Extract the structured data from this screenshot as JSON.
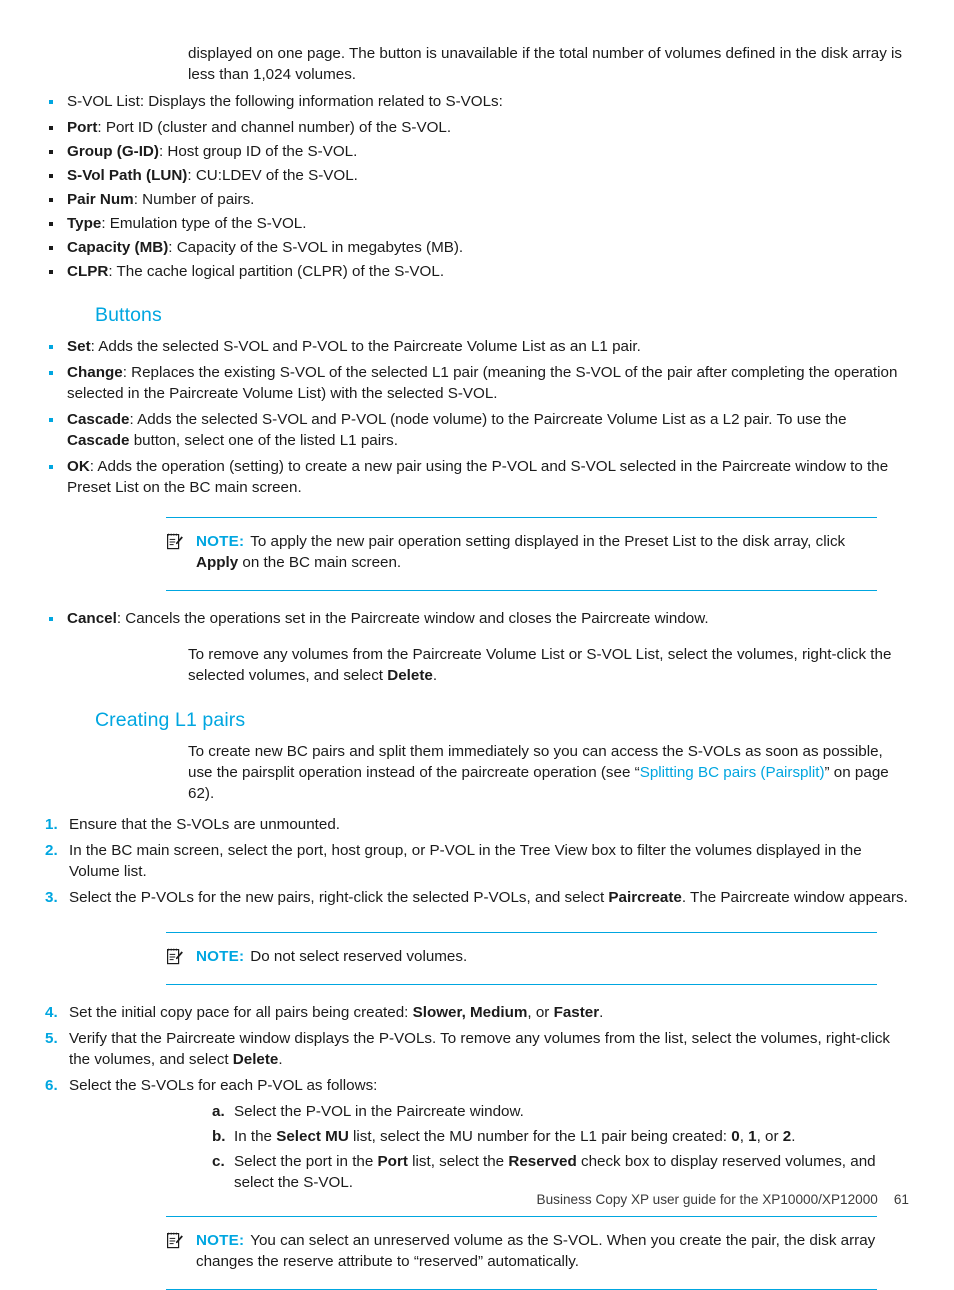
{
  "document": {
    "footer_text": "Business Copy XP user guide for the XP10000/XP12000",
    "page_number": "61"
  },
  "colors": {
    "accent": "#00a6e0",
    "text": "#1b1b1b"
  },
  "intro": {
    "continuation_paragraph": "displayed on one page. The button is unavailable if the total number of volumes defined in the disk array is less than 1,024 volumes.",
    "svol_list_bullet": "S-VOL List: Displays the following information related to S-VOLs:",
    "svol_fields": [
      {
        "term": "Port",
        "desc": ": Port ID (cluster and channel number) of the S-VOL."
      },
      {
        "term": "Group (G-ID)",
        "desc": ": Host group ID of the S-VOL."
      },
      {
        "term": "S-Vol Path (LUN)",
        "desc": ": CU:LDEV of the S-VOL."
      },
      {
        "term": "Pair Num",
        "desc": ": Number of pairs."
      },
      {
        "term": "Type",
        "desc": ": Emulation type of the S-VOL."
      },
      {
        "term": "Capacity (MB)",
        "desc": ": Capacity of the S-VOL in megabytes (MB)."
      },
      {
        "term": "CLPR",
        "desc": ": The cache logical partition (CLPR) of the S-VOL."
      }
    ]
  },
  "buttons_section": {
    "heading": "Buttons",
    "items": [
      {
        "term": "Set",
        "desc": ": Adds the selected S-VOL and P-VOL to the Paircreate Volume List as an L1 pair."
      },
      {
        "term": "Change",
        "desc": ": Replaces the existing S-VOL of the selected L1 pair (meaning the S-VOL of the pair after completing the operation selected in the Paircreate Volume List) with the selected S-VOL."
      },
      {
        "term": "Cascade",
        "desc_1": ": Adds the selected S-VOL and P-VOL (node volume) to the Paircreate Volume List as a L2 pair. To use the ",
        "emphasis": "Cascade",
        "desc_2": " button, select one of the listed L1 pairs."
      },
      {
        "term": "OK",
        "desc": ": Adds the operation (setting) to create a new pair using the P-VOL and S-VOL selected in the Paircreate window to the Preset List on the BC main screen."
      }
    ],
    "note_1": {
      "label": "NOTE:",
      "text_1": "To apply the new pair operation setting displayed in the Preset List to the disk array, click ",
      "emphasis": "Apply",
      "text_2": " on the BC main screen."
    },
    "cancel_item": {
      "term": "Cancel",
      "desc": ": Cancels the operations set in the Paircreate window and closes the Paircreate window."
    },
    "remove_paragraph_1": "To remove any volumes from the Paircreate Volume List or S-VOL List, select the volumes, right-click the selected volumes, and select ",
    "remove_paragraph_emphasis": "Delete",
    "remove_paragraph_2": "."
  },
  "creating_l1_section": {
    "heading": "Creating L1 pairs",
    "intro_1": "To create new BC pairs and split them immediately so you can access the S-VOLs as soon as possible, use the pairsplit operation instead of the paircreate operation (see “",
    "intro_link": "Splitting BC pairs (Pairsplit)",
    "intro_2": "” on page 62).",
    "steps": [
      {
        "num": "1.",
        "text": "Ensure that the S-VOLs are unmounted."
      },
      {
        "num": "2.",
        "text": "In the BC main screen, select the port, host group, or P-VOL in the Tree View box to filter the volumes displayed in the Volume list."
      },
      {
        "num": "3.",
        "text_1": "Select the P-VOLs for the new pairs, right-click the selected P-VOLs, and select ",
        "emphasis": "Paircreate",
        "text_2": ". The Paircreate window appears."
      }
    ],
    "note_2": {
      "label": "NOTE:",
      "text": "Do not select reserved volumes."
    },
    "steps_cont": [
      {
        "num": "4.",
        "text_1": "Set the initial copy pace for all pairs being created: ",
        "emphasis": "Slower, Medium",
        "text_2": ", or ",
        "emphasis_2": "Faster",
        "text_3": "."
      },
      {
        "num": "5.",
        "text_1": "Verify that the Paircreate window displays the P-VOLs. To remove any volumes from the list, select the volumes, right-click the volumes, and select ",
        "emphasis": "Delete",
        "text_2": "."
      },
      {
        "num": "6.",
        "text": "Select the S-VOLs for each P-VOL as follows:"
      }
    ],
    "substeps": [
      {
        "num": "a.",
        "text": "Select the P-VOL in the Paircreate window."
      },
      {
        "num": "b.",
        "text_1": "In the ",
        "emphasis": "Select MU",
        "text_2": " list, select the MU number for the L1 pair being created: ",
        "emphasis_2": "0",
        "text_3": ", ",
        "emphasis_3": "1",
        "text_4": ", or ",
        "emphasis_4": "2",
        "text_5": "."
      },
      {
        "num": "c.",
        "text_1": "Select the port in the ",
        "emphasis": "Port",
        "text_2": " list, select the ",
        "emphasis_2": "Reserved",
        "text_3": " check box to display reserved volumes, and select the S-VOL."
      }
    ],
    "note_3": {
      "label": "NOTE:",
      "text": "You can select an unreserved volume as the S-VOL. When you create the pair, the disk array changes the reserve attribute to “reserved” automatically."
    }
  }
}
